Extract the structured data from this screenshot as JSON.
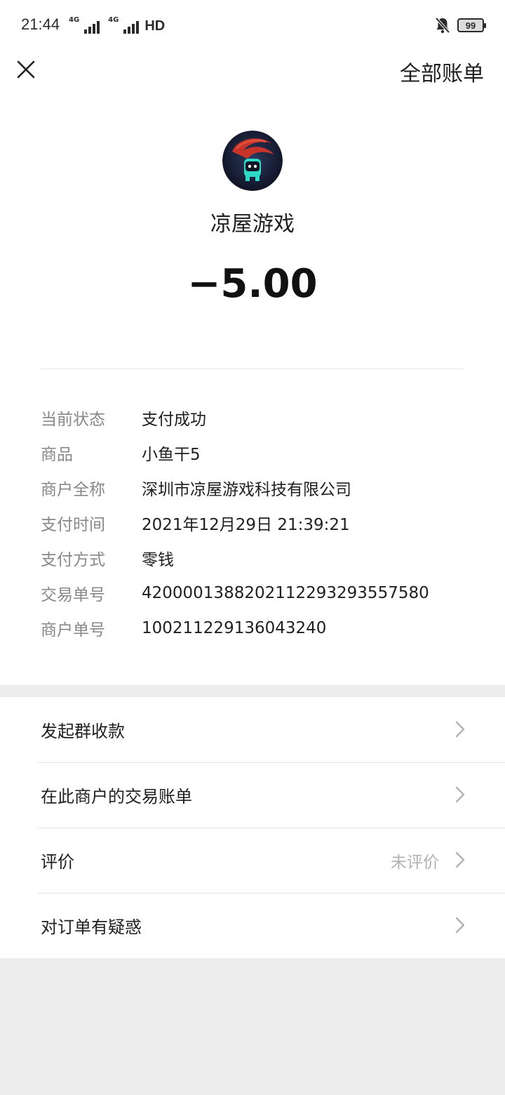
{
  "status_bar": {
    "time": "21:44",
    "network_1": "4G",
    "network_2": "4G",
    "hd_label": "HD",
    "battery": "99"
  },
  "nav": {
    "close_icon": "close-icon",
    "all_bills_label": "全部账单"
  },
  "header": {
    "merchant_name": "凉屋游戏",
    "amount": "−5.00"
  },
  "details": [
    {
      "key": "当前状态",
      "value": "支付成功"
    },
    {
      "key": "商品",
      "value": "小鱼干5"
    },
    {
      "key": "商户全称",
      "value": "深圳市凉屋游戏科技有限公司"
    },
    {
      "key": "支付时间",
      "value": "2021年12月29日 21:39:21"
    },
    {
      "key": "支付方式",
      "value": "零钱"
    },
    {
      "key": "交易单号",
      "value": "4200001388202112293293557580"
    },
    {
      "key": "商户单号",
      "value": "100211229136043240"
    }
  ],
  "menu": [
    {
      "label": "发起群收款",
      "extra": ""
    },
    {
      "label": "在此商户的交易账单",
      "extra": ""
    },
    {
      "label": "评价",
      "extra": "未评价"
    },
    {
      "label": "对订单有疑惑",
      "extra": ""
    }
  ],
  "colors": {
    "background": "#ededed",
    "card": "#ffffff",
    "muted_text": "#888888",
    "primary_text": "#1f1f1f"
  }
}
